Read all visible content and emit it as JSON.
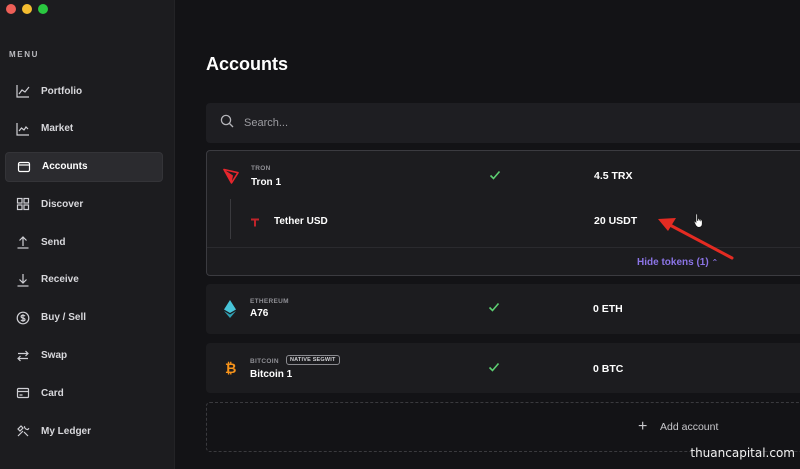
{
  "window": {
    "traffic_lights": [
      "#ee5f57",
      "#f5bd30",
      "#2ac840"
    ]
  },
  "sidebar": {
    "menu_label": "MENU",
    "items": [
      {
        "label": "Portfolio",
        "icon": "chart-line-icon",
        "active": false
      },
      {
        "label": "Market",
        "icon": "trend-chart-icon",
        "active": false
      },
      {
        "label": "Accounts",
        "icon": "wallet-icon",
        "active": true
      },
      {
        "label": "Discover",
        "icon": "grid-icon",
        "active": false
      },
      {
        "label": "Send",
        "icon": "arrow-up-icon",
        "active": false
      },
      {
        "label": "Receive",
        "icon": "arrow-down-icon",
        "active": false
      },
      {
        "label": "Buy / Sell",
        "icon": "dollar-circle-icon",
        "active": false
      },
      {
        "label": "Swap",
        "icon": "swap-arrows-icon",
        "active": false
      },
      {
        "label": "Card",
        "icon": "card-icon",
        "active": false
      },
      {
        "label": "My Ledger",
        "icon": "tools-icon",
        "active": false
      }
    ]
  },
  "main": {
    "title": "Accounts",
    "search": {
      "placeholder": "Search..."
    },
    "accounts": [
      {
        "chain": "TRON",
        "name": "Tron 1",
        "synced": true,
        "balance": "4.5 TRX",
        "icon": "tron-icon",
        "color": "#e5262d",
        "tokens": [
          {
            "name": "Tether USD",
            "balance": "20 USDT",
            "icon": "tether-icon",
            "color": "#c0232a"
          }
        ],
        "hide_tokens": "Hide tokens (1)"
      },
      {
        "chain": "ETHEREUM",
        "name": "A76",
        "synced": true,
        "balance": "0 ETH",
        "icon": "ethereum-icon",
        "color": "#47c4d8"
      },
      {
        "chain": "BITCOIN",
        "badge": "NATIVE SEGWIT",
        "name": "Bitcoin 1",
        "synced": true,
        "balance": "0 BTC",
        "icon": "bitcoin-icon",
        "color": "#f7931a"
      }
    ],
    "add_account": "Add account"
  },
  "colors": {
    "accent": "#8b74e6",
    "check": "#5dcf72",
    "annotation_arrow": "#e32b22"
  },
  "watermark": "thuancapital.com"
}
